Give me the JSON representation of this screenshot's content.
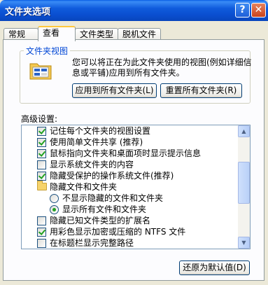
{
  "window": {
    "title": "文件夹选项",
    "help_label": "?",
    "close_label": "✕"
  },
  "tabs": [
    {
      "label": "常规",
      "active": false
    },
    {
      "label": "查看",
      "active": true
    },
    {
      "label": "文件类型",
      "active": false
    },
    {
      "label": "脱机文件",
      "active": false
    }
  ],
  "folder_views": {
    "group_label": "文件夹视图",
    "description": "您可以将正在为此文件夹使用的视图(例如详细信息或平铺)应用到所有文件夹。",
    "apply_button": "应用到所有文件夹(L)",
    "reset_button": "重置所有文件夹(R)"
  },
  "advanced": {
    "label": "高级设置:",
    "items": [
      {
        "type": "checkbox",
        "checked": true,
        "label": "记住每个文件夹的视图设置"
      },
      {
        "type": "checkbox",
        "checked": true,
        "label": "使用简单文件共享 (推荐)"
      },
      {
        "type": "checkbox",
        "checked": true,
        "label": "鼠标指向文件夹和桌面项时显示提示信息"
      },
      {
        "type": "checkbox",
        "checked": false,
        "label": "显示系统文件夹的内容"
      },
      {
        "type": "checkbox",
        "checked": true,
        "label": "隐藏受保护的操作系统文件(推荐)"
      },
      {
        "type": "folder",
        "label": "隐藏文件和文件夹"
      },
      {
        "type": "radio",
        "checked": false,
        "label": "不显示隐藏的文件和文件夹"
      },
      {
        "type": "radio",
        "checked": true,
        "label": "显示所有文件和文件夹"
      },
      {
        "type": "checkbox",
        "checked": false,
        "label": "隐藏已知文件类型的扩展名"
      },
      {
        "type": "checkbox",
        "checked": true,
        "label": "用彩色显示加密或压缩的 NTFS 文件"
      },
      {
        "type": "checkbox",
        "checked": false,
        "label": "在标题栏显示完整路径"
      }
    ],
    "restore_button": "还原为默认值(D)"
  }
}
